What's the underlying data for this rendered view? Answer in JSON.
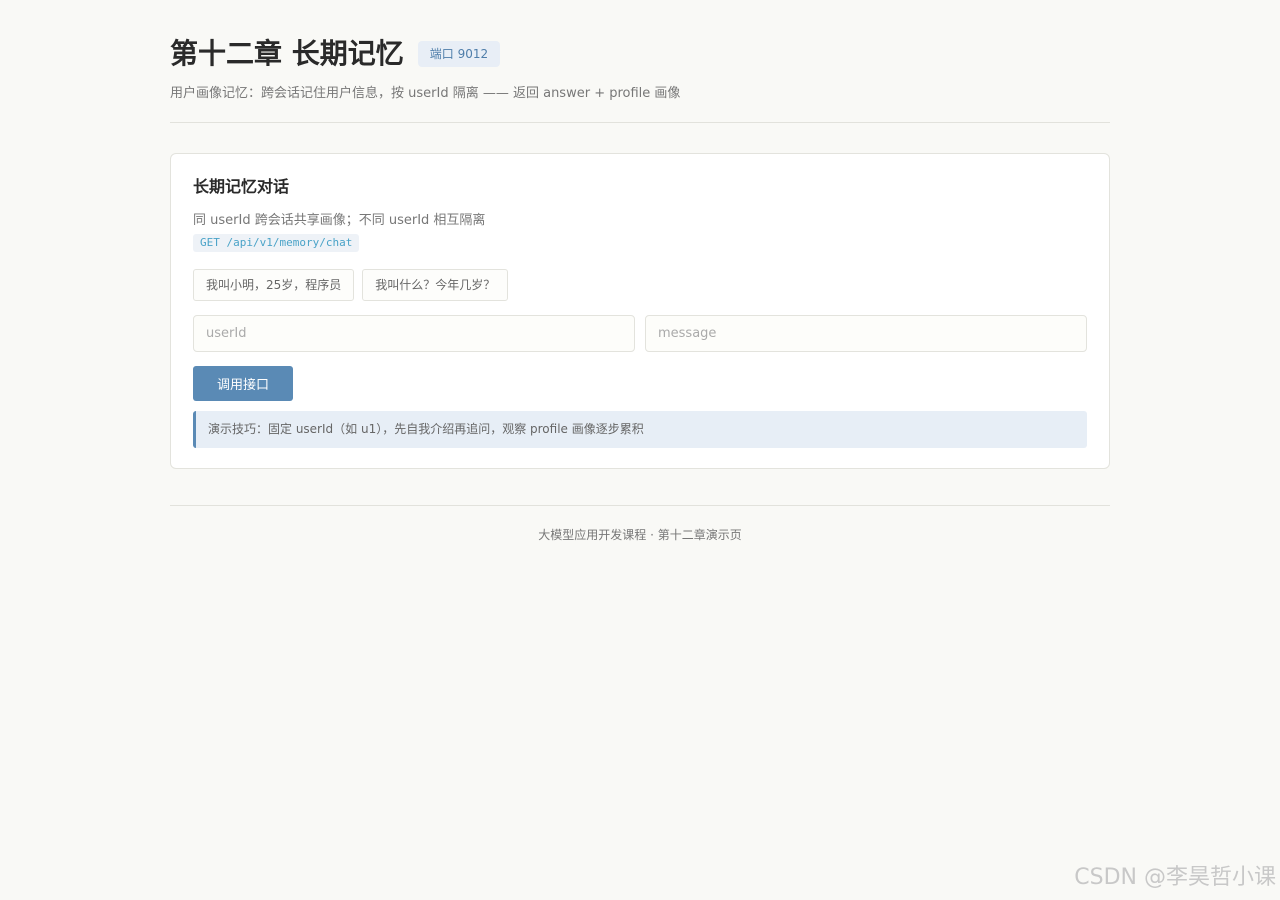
{
  "header": {
    "title": "第十二章 长期记忆",
    "port_badge": "端口 9012",
    "subtitle": "用户画像记忆：跨会话记住用户信息，按 userId 隔离 —— 返回 answer + profile 画像"
  },
  "card": {
    "title": "长期记忆对话",
    "description": "同 userId 跨会话共享画像；不同 userId 相互隔离",
    "endpoint": "GET /api/v1/memory/chat",
    "presets": [
      {
        "label": "我叫小明，25岁，程序员"
      },
      {
        "label": "我叫什么？今年几岁？"
      }
    ],
    "inputs": {
      "user_id": {
        "placeholder": "userId",
        "value": ""
      },
      "message": {
        "placeholder": "message",
        "value": ""
      }
    },
    "call_button": "调用接口",
    "tip": "演示技巧：固定 userId（如 u1），先自我介绍再追问，观察 profile 画像逐步累积"
  },
  "footer": {
    "text": "大模型应用开发课程 · 第十二章演示页"
  },
  "watermark": "CSDN @李昊哲小课",
  "colors": {
    "accent": "#5a8ab5",
    "background": "#f9f9f6",
    "endpoint_text": "#4aa3c8"
  }
}
